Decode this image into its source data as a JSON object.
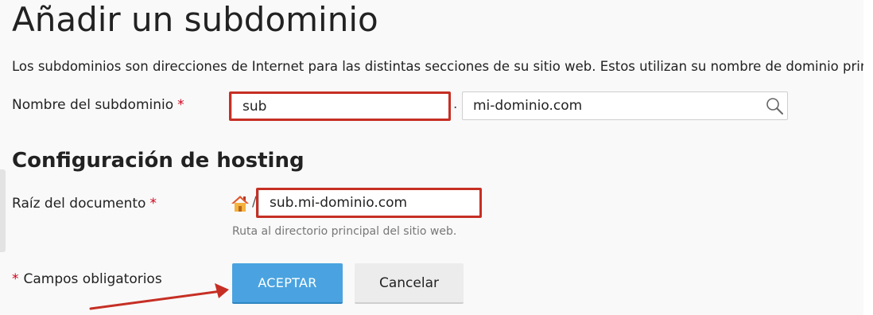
{
  "page": {
    "title": "Añadir un subdominio",
    "intro": "Los subdominios son direcciones de Internet para las distintas secciones de su sitio web. Estos utilizan su nombre de dominio principal"
  },
  "subdomain": {
    "label": "Nombre del subdominio",
    "required_mark": "*",
    "value": "sub",
    "separator": ".",
    "domain_value": "mi-dominio.com",
    "domain_icon": "search-icon"
  },
  "hosting": {
    "title": "Configuración de hosting",
    "docroot_label": "Raíz del documento",
    "required_mark": "*",
    "home_icon": "home-icon",
    "path_separator": "/",
    "docroot_value": "sub.mi-dominio.com",
    "docroot_hint": "Ruta al directorio principal del sitio web."
  },
  "footer": {
    "required_note": "Campos obligatorios",
    "required_mark": "*",
    "accept_label": "Aceptar",
    "cancel_label": "Cancelar"
  },
  "colors": {
    "accent": "#4aa3e0",
    "annotation": "#c62f24",
    "required": "#d0021b"
  }
}
